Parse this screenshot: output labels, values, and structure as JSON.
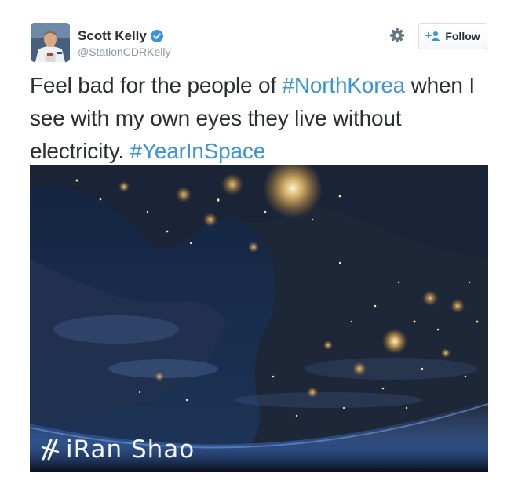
{
  "author": {
    "display_name": "Scott Kelly",
    "handle": "@StationCDRKelly",
    "verified": true
  },
  "actions": {
    "follow_label": "Follow",
    "settings_icon": "gear-icon",
    "follow_icon": "add-user-icon"
  },
  "tweet": {
    "text_before": "Feel bad for the people of ",
    "hashtag_1": "#NorthKorea",
    "text_after": " when I see with my own eyes they live without electricity. ",
    "hashtag_2": "#YearInSpace"
  },
  "media": {
    "watermark_text": "iRan Shao"
  },
  "colors": {
    "hashtag": "#3b94d9",
    "verified_badge": "#3b94d9",
    "handle": "#8899a6",
    "text": "#292f33"
  }
}
